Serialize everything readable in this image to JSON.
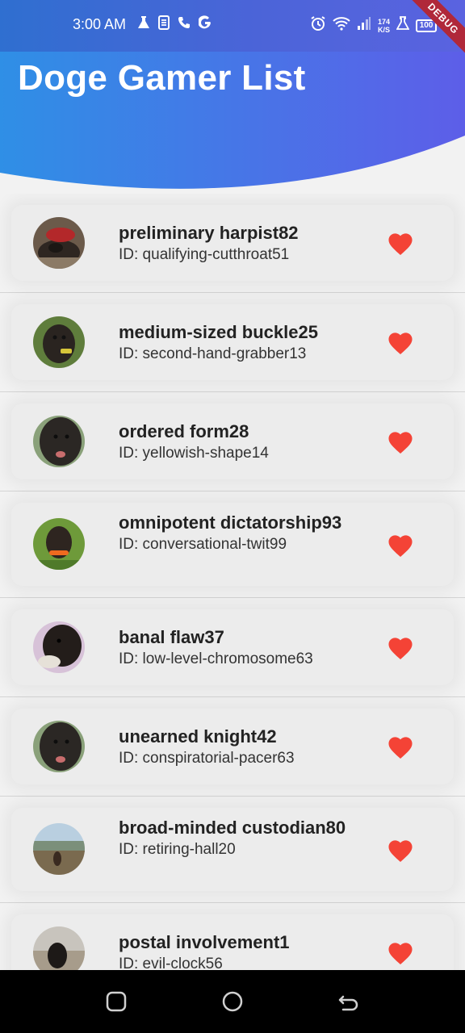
{
  "status_bar": {
    "time": "3:00 AM",
    "left_icons": [
      "flask-icon",
      "s-icon",
      "phone-icon",
      "google-g-icon"
    ],
    "right_icons": [
      "alarm-icon",
      "wifi-icon",
      "signal-icon",
      "flask-icon"
    ],
    "network_speed_value": "174",
    "network_speed_unit": "K/S",
    "battery_level": "100"
  },
  "debug_banner": "DEBUG",
  "header": {
    "title": "Doge Gamer List",
    "gradient_start": "#2f8fe6",
    "gradient_end": "#5d5ee8"
  },
  "list": {
    "items": [
      {
        "name": "preliminary harpist82",
        "id_text": "ID: qualifying-cutthroat51",
        "avatar": "dog-avatar-red-hat"
      },
      {
        "name": "medium-sized buckle25",
        "id_text": "ID: second-hand-grabber13",
        "avatar": "dog-avatar-grass"
      },
      {
        "name": "ordered form28",
        "id_text": "ID: yellowish-shape14",
        "avatar": "dog-avatar-closeup"
      },
      {
        "name": "omnipotent dictatorship93",
        "id_text": "ID: conversational-twit99",
        "avatar": "dog-avatar-orange-collar"
      },
      {
        "name": "banal flaw37",
        "id_text": "ID: low-level-chromosome63",
        "avatar": "dog-avatar-dark"
      },
      {
        "name": "unearned knight42",
        "id_text": "ID: conspiratorial-pacer63",
        "avatar": "dog-avatar-closeup"
      },
      {
        "name": "broad-minded custodian80",
        "id_text": "ID: retiring-hall20",
        "avatar": "dog-avatar-landscape"
      },
      {
        "name": "postal involvement1",
        "id_text": "ID: evil-clock56",
        "avatar": "dog-avatar-beach"
      }
    ],
    "favorite_icon": "heart-icon",
    "favorite_color": "#f44336"
  },
  "nav_bar": {
    "buttons": [
      "recent-apps-icon",
      "home-icon",
      "back-icon"
    ]
  }
}
